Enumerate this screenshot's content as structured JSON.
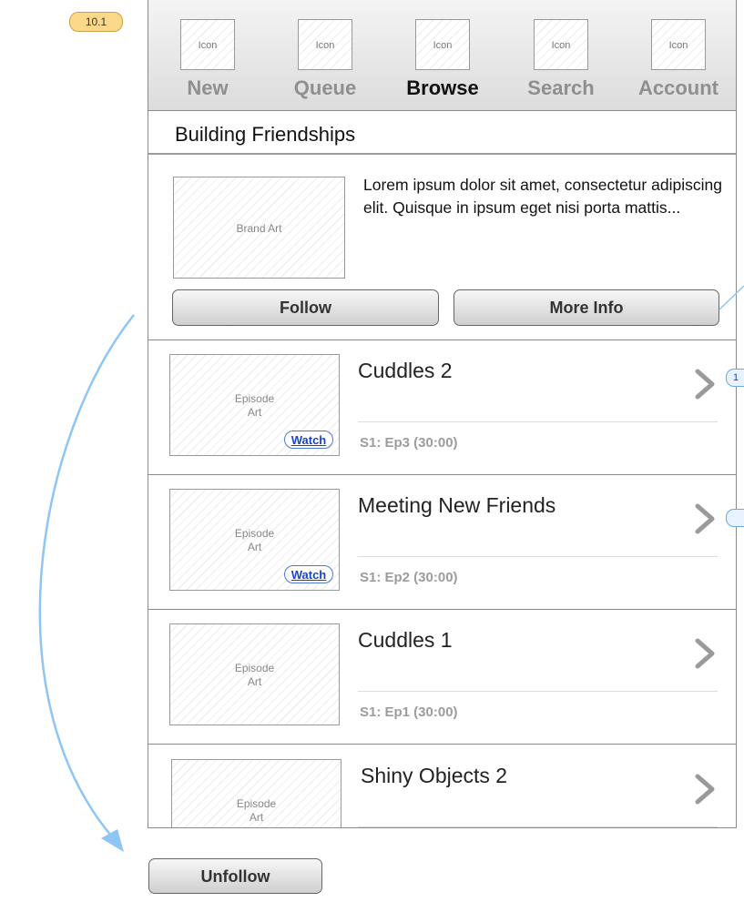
{
  "annotation": {
    "badge": "10.1",
    "side_badge": "1"
  },
  "tabs": [
    {
      "icon": "Icon",
      "label": "New",
      "active": false
    },
    {
      "icon": "Icon",
      "label": "Queue",
      "active": false
    },
    {
      "icon": "Icon",
      "label": "Browse",
      "active": true
    },
    {
      "icon": "Icon",
      "label": "Search",
      "active": false
    },
    {
      "icon": "Icon",
      "label": "Account",
      "active": false
    }
  ],
  "page_title": "Building Friendships",
  "brand": {
    "art_label": "Brand Art",
    "description": "Lorem ipsum dolor sit amet, consectetur adipiscing elit. Quisque in ipsum eget nisi porta mattis...",
    "follow_label": "Follow",
    "more_info_label": "More Info"
  },
  "episodes": [
    {
      "art_line1": "Episode",
      "art_line2": "Art",
      "watch": "Watch",
      "title": "Cuddles 2",
      "meta": "S1: Ep3 (30:00)"
    },
    {
      "art_line1": "Episode",
      "art_line2": "Art",
      "watch": "Watch",
      "title": "Meeting New Friends",
      "meta": "S1: Ep2 (30:00)"
    },
    {
      "art_line1": "Episode",
      "art_line2": "Art",
      "title": "Cuddles 1",
      "meta": "S1: Ep1 (30:00)"
    },
    {
      "art_line1": "Episode",
      "art_line2": "Art",
      "title": "Shiny Objects 2"
    }
  ],
  "unfollow_label": "Unfollow",
  "colors": {
    "annotation_badge": "#fcd98a",
    "flow_arrow": "#8ec5f5",
    "link": "#1a44c8"
  }
}
